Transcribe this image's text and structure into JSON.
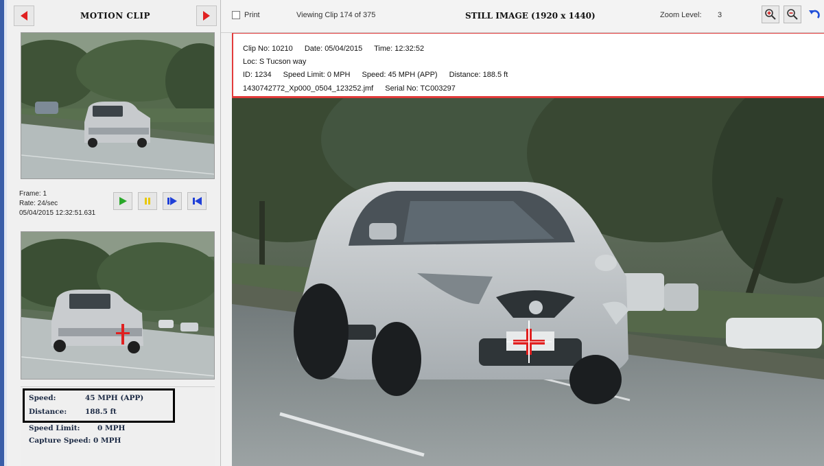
{
  "motion_clip": {
    "title": "MOTION CLIP",
    "prev_icon": "left-arrow-icon",
    "next_icon": "right-arrow-icon"
  },
  "frame_info": {
    "frame": "Frame: 1",
    "rate": "Rate: 24/sec",
    "timestamp": "05/04/2015 12:32:51.631"
  },
  "playback": {
    "play_icon": "play-icon",
    "pause_icon": "pause-icon",
    "step_icon": "step-forward-icon",
    "rewind_icon": "skip-to-start-icon"
  },
  "stats": {
    "speed_label": "Speed:",
    "speed_value": "45 MPH (APP)",
    "distance_label": "Distance:",
    "distance_value": "188.5 ft",
    "limit_label": "Speed Limit:",
    "limit_value": "0 MPH",
    "capture_label": "Capture Speed:",
    "capture_value": "0 MPH"
  },
  "toolbar": {
    "print_label": "Print",
    "viewing": "Viewing Clip 174 of 375",
    "still_title": "STILL IMAGE (1920 x 1440)",
    "zoom_label": "Zoom Level:",
    "zoom_value": "3",
    "zoom_in_icon": "zoom-in-icon",
    "zoom_out_icon": "zoom-out-icon",
    "undo_icon": "undo-icon"
  },
  "clip": {
    "clip_no": "Clip No: 10210",
    "date": "Date: 05/04/2015",
    "time": "Time: 12:32:52",
    "loc": "Loc: S Tucson way",
    "id": "ID: 1234",
    "speed_limit": "Speed Limit: 0 MPH",
    "speed": "Speed: 45 MPH (APP)",
    "distance": "Distance: 188.5 ft",
    "file": "1430742772_Xp000_0504_123252.jmf",
    "serial": "Serial No: TC003297"
  },
  "colors": {
    "accent_red": "#e02020",
    "banner_border": "#e23a3a",
    "play_green": "#2aa82a",
    "pause_yellow": "#e8c800",
    "step_blue": "#1f3fd8"
  }
}
